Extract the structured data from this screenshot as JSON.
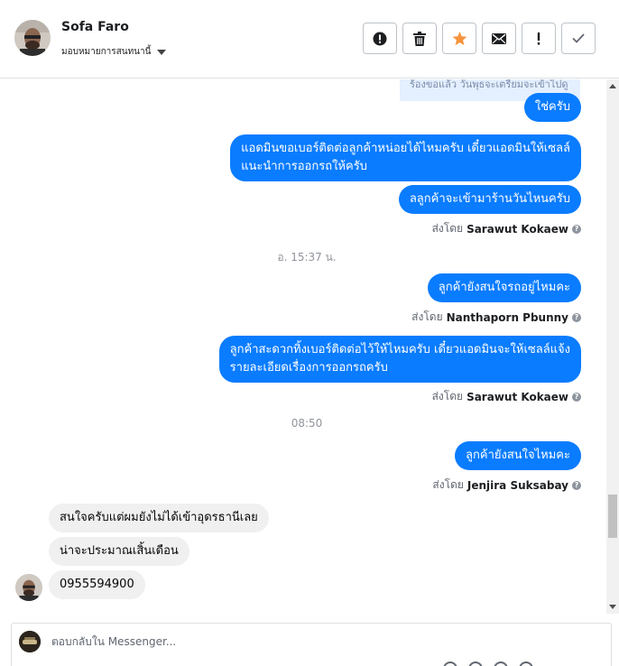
{
  "header": {
    "contact_name": "Sofa Faro",
    "assign_label": "มอบหมายการสนทนานี้"
  },
  "toolbar": {
    "buttons": [
      "mark-spam",
      "delete",
      "star",
      "mark-unread",
      "follow-up",
      "done"
    ]
  },
  "colors": {
    "outgoing_bubble": "#0a7cff",
    "incoming_bubble": "#f0f0f0",
    "star": "#f7923b"
  },
  "messages": {
    "partial_prev": "ร้องขอแล้ว วันพุธจะเตรียมจะเข้าไปดู",
    "m1": "ใช่ครับ",
    "m2_line1": "แอดมินขอเบอร์ติดต่อลูกค้าหน่อยได้ไหมครับ เดี๋ยวแอดมินให้เซลล์",
    "m2_line2": "แนะนำการออกรถให้ครับ",
    "m3": "ลลูกค้าจะเข้ามาร้านวันไหนครับ",
    "sent1_prefix": "ส่งโดย",
    "sent1_name": "Sarawut Kokaew",
    "time1": "อ. 15:37 น.",
    "m4": "ลูกค้ายังสนใจรถอยู่ไหมคะ",
    "sent2_prefix": "ส่งโดย",
    "sent2_name": "Nanthaporn Pbunny",
    "m5_line1": "ลูกค้าสะดวกทิ้งเบอร์ติดต่อไว้ให้ไหมครับ เดี๋ยวแอดมินจะให้เซลล์แจ้ง",
    "m5_line2": "รายละเอียดเรื่องการออกรถครับ",
    "sent3_prefix": "ส่งโดย",
    "sent3_name": "Sarawut Kokaew",
    "time2": "08:50",
    "m6": "ลูกค้ายังสนใจไหมคะ",
    "sent4_prefix": "ส่งโดย",
    "sent4_name": "Jenjira Suksabay",
    "in1": "สนใจครับแต่ผมยังไม่ได้เข้าอุดรธานีเลย",
    "in2": "น่าจะประมาณเสิ้นเดือน",
    "in3": "0955594900"
  },
  "composer": {
    "placeholder": "ตอบกลับใน Messenger..."
  }
}
